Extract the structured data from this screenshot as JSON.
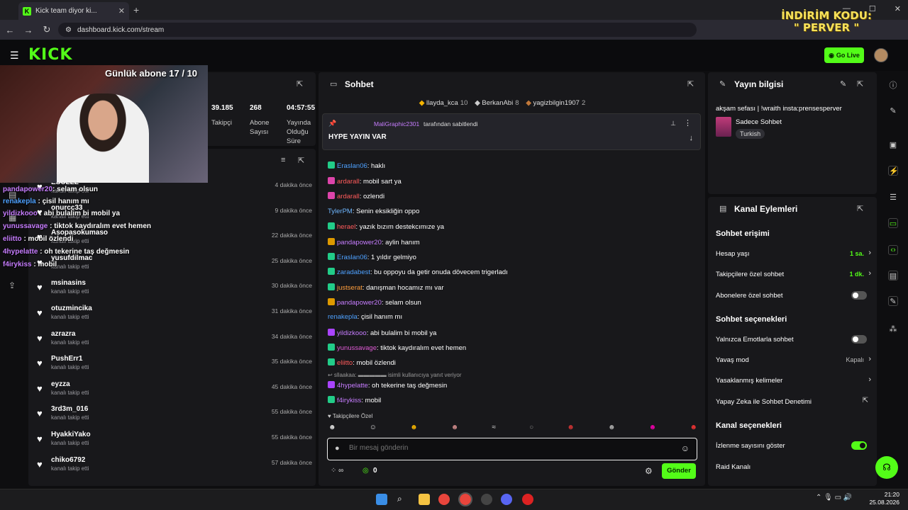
{
  "browser": {
    "tab_title": "Kick team diyor ki...",
    "url": "dashboard.kick.com/stream"
  },
  "promo": {
    "line1": "İNDİRİM KODU:",
    "line2": "\" PERVER \""
  },
  "header": {
    "logo": "KICK",
    "go_live": "Go Live"
  },
  "webcam": {
    "caption": "Günlük abone 17 / 10"
  },
  "stats": [
    {
      "value": "39.185",
      "label": "Takipçi"
    },
    {
      "value": "268",
      "label": "Abone Sayısı"
    },
    {
      "value": "04:57:55",
      "label": "Yayında Olduğu Süre"
    }
  ],
  "overlay_chat": [
    {
      "user": "pandapower20",
      "text": ": selam olsun",
      "color": "#c77dff"
    },
    {
      "user": "renakepla",
      "text": " : çisil hanım mı",
      "color": "#4ea1ff"
    },
    {
      "user": "yildizkooo",
      "text": " : abi bulalim bi mobil ya",
      "color": "#c77dff"
    },
    {
      "user": "yunussavage",
      "text": " : tiktok kaydıralım evet hemen",
      "color": "#c77dff"
    },
    {
      "user": "eliitto",
      "text": " : mobil özlendi",
      "color": "#c77dff"
    },
    {
      "user": "4hypelatte",
      "text": " : oh tekerine taş değmesin",
      "color": "#c77dff"
    },
    {
      "user": "f4irykiss",
      "text": " : mobil",
      "color": "#c77dff"
    }
  ],
  "followers": [
    {
      "name": "ESULLL",
      "sub": "kanalı takip etti",
      "time": "4 dakika önce"
    },
    {
      "name": "onurcc33",
      "sub": "kanalı takip etti",
      "time": "9 dakika önce"
    },
    {
      "name": "Asopasokumaso",
      "sub": "kanalı takip etti",
      "time": "22 dakika önce"
    },
    {
      "name": "yusufdilmac",
      "sub": "kanalı takip etti",
      "time": "25 dakika önce"
    },
    {
      "name": "msinasins",
      "sub": "kanalı takip etti",
      "time": "30 dakika önce"
    },
    {
      "name": "otuzmincika",
      "sub": "kanalı takip etti",
      "time": "31 dakika önce"
    },
    {
      "name": "azrazra",
      "sub": "kanalı takip etti",
      "time": "34 dakika önce"
    },
    {
      "name": "PushErr1",
      "sub": "kanalı takip etti",
      "time": "35 dakika önce"
    },
    {
      "name": "eyzza",
      "sub": "kanalı takip etti",
      "time": "45 dakika önce"
    },
    {
      "name": "3rd3m_016",
      "sub": "kanalı takip etti",
      "time": "55 dakika önce"
    },
    {
      "name": "HyakkiYako",
      "sub": "kanalı takip etti",
      "time": "55 dakika önce"
    },
    {
      "name": "chiko6792",
      "sub": "kanalı takip etti",
      "time": "57 dakika önce"
    }
  ],
  "chat": {
    "title": "Sohbet",
    "leaders": [
      {
        "name": "llayda_kca",
        "count": "10"
      },
      {
        "name": "BerkanAbi",
        "count": "8"
      },
      {
        "name": "yagizbilgin1907",
        "count": "2"
      }
    ],
    "pinned_by": "MaliGraphic2301",
    "pinned_suffix": "tarafından sabitlendi",
    "pinned_text": "HYPE YAYIN VAR",
    "messages": [
      {
        "user": "Eraslan06",
        "text": ": haklı",
        "color": "#4ea1ff"
      },
      {
        "user": "ardarall",
        "text": ": mobil sart ya",
        "color": "#ff5b5b"
      },
      {
        "user": "ardarall",
        "text": ": ozlendi",
        "color": "#ff5b5b"
      },
      {
        "user": "TylerPM",
        "text": ": Senin eksikliğin oppo",
        "color": "#6fb7ff"
      },
      {
        "user": "herael",
        "text": ": yazık bızım destekcımıze ya",
        "color": "#ff5b5b"
      },
      {
        "user": "pandapower20",
        "text": ": aylin hanım",
        "color": "#c77dff"
      },
      {
        "user": "Eraslan06",
        "text": ": 1 yıldır gelmiyo",
        "color": "#4ea1ff"
      },
      {
        "user": "zaradabest",
        "text": ": bu oppoyu da getir onuda dövecem trigerladı",
        "color": "#4ea1ff"
      },
      {
        "user": "justserat",
        "text": ": danışman hocamız mı var",
        "color": "#ff9e3d"
      },
      {
        "user": "pandapower20",
        "text": ": selam olsun",
        "color": "#c77dff"
      },
      {
        "user": "renakepla",
        "text": ": çisil hanım mı",
        "color": "#4ea1ff"
      },
      {
        "user": "yildizkooo",
        "text": ": abi bulalim bi mobil ya",
        "color": "#c77dff"
      },
      {
        "user": "yunussavage",
        "text": ": tiktok kaydıralım evet hemen",
        "color": "#e05bd6"
      },
      {
        "user": "eliitto",
        "text": ": mobil özlendi",
        "color": "#ff5b5b"
      },
      {
        "user": "4hypelatte",
        "text": ": oh tekerine taş değmesin",
        "color": "#c77dff"
      },
      {
        "user": "f4irykiss",
        "text": ": mobil",
        "color": "#c77dff"
      }
    ],
    "reply_note": "isimli kullanıcıya yanıt veriyor",
    "followers_only": "Takipçilere Özel",
    "input_placeholder": "Bir mesaj gönderin",
    "points": "0",
    "send": "Gönder"
  },
  "stream_info": {
    "title": "Yayın bilgisi",
    "stream_title": "akşam sefası | !wraith insta:prensesperver",
    "category": "Sadece Sohbet",
    "language": "Turkish"
  },
  "channel_actions": {
    "title": "Kanal Eylemleri",
    "chat_access": "Sohbet erişimi",
    "account_age": "Hesap yaşı",
    "account_age_val": "1 sa.",
    "followers_only": "Takipçilere özel sohbet",
    "followers_only_val": "1 dk.",
    "subs_only": "Abonelere özel sohbet",
    "chat_options": "Sohbet seçenekleri",
    "emote_only": "Yalnızca Emotlarla sohbet",
    "slow_mode": "Yavaş mod",
    "slow_mode_val": "Kapalı",
    "banned_words": "Yasaklanmış kelimeler",
    "ai_moderation": "Yapay Zeka ile Sohbet Denetimi",
    "channel_options": "Kanal seçenekleri",
    "show_viewers": "İzlenme sayısını göster",
    "raid": "Raid Kanalı"
  },
  "taskbar": {
    "time": "21:20",
    "date": "25.08.2026"
  },
  "colors": {
    "accent": "#53fc18",
    "panel": "#18181b"
  }
}
